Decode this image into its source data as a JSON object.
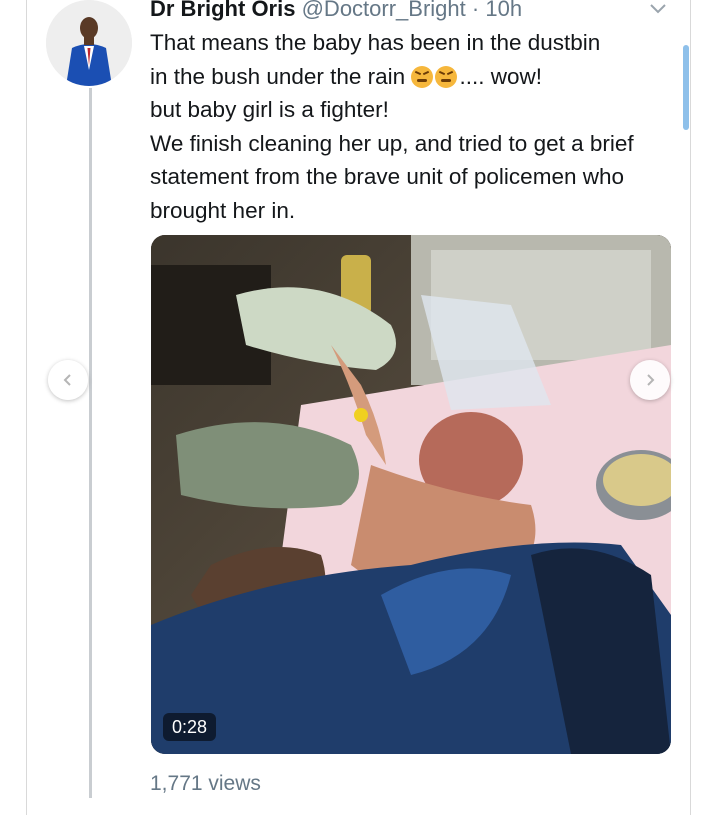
{
  "tweet": {
    "author_name": "Dr Bright Oris",
    "author_handle": "@Doctorr_Bright",
    "separator": "·",
    "time": "10h",
    "lines": [
      "That means the baby has been in the dustbin",
      "in the bush under the rain",
      ".... wow!",
      "but baby girl is a fighter!",
      "We finish cleaning her up, and tried to get a brief statement from the brave unit of policemen who brought her in."
    ],
    "emoji_name": "tired-face-emoji",
    "video_duration": "0:28",
    "views": "1,771 views"
  },
  "icons": {
    "menu": "chevron-down-icon",
    "prev": "chevron-left-icon",
    "next": "chevron-right-icon"
  },
  "colors": {
    "text": "#14171a",
    "secondary": "#657786",
    "scroll_accent": "#8ec0ea"
  }
}
